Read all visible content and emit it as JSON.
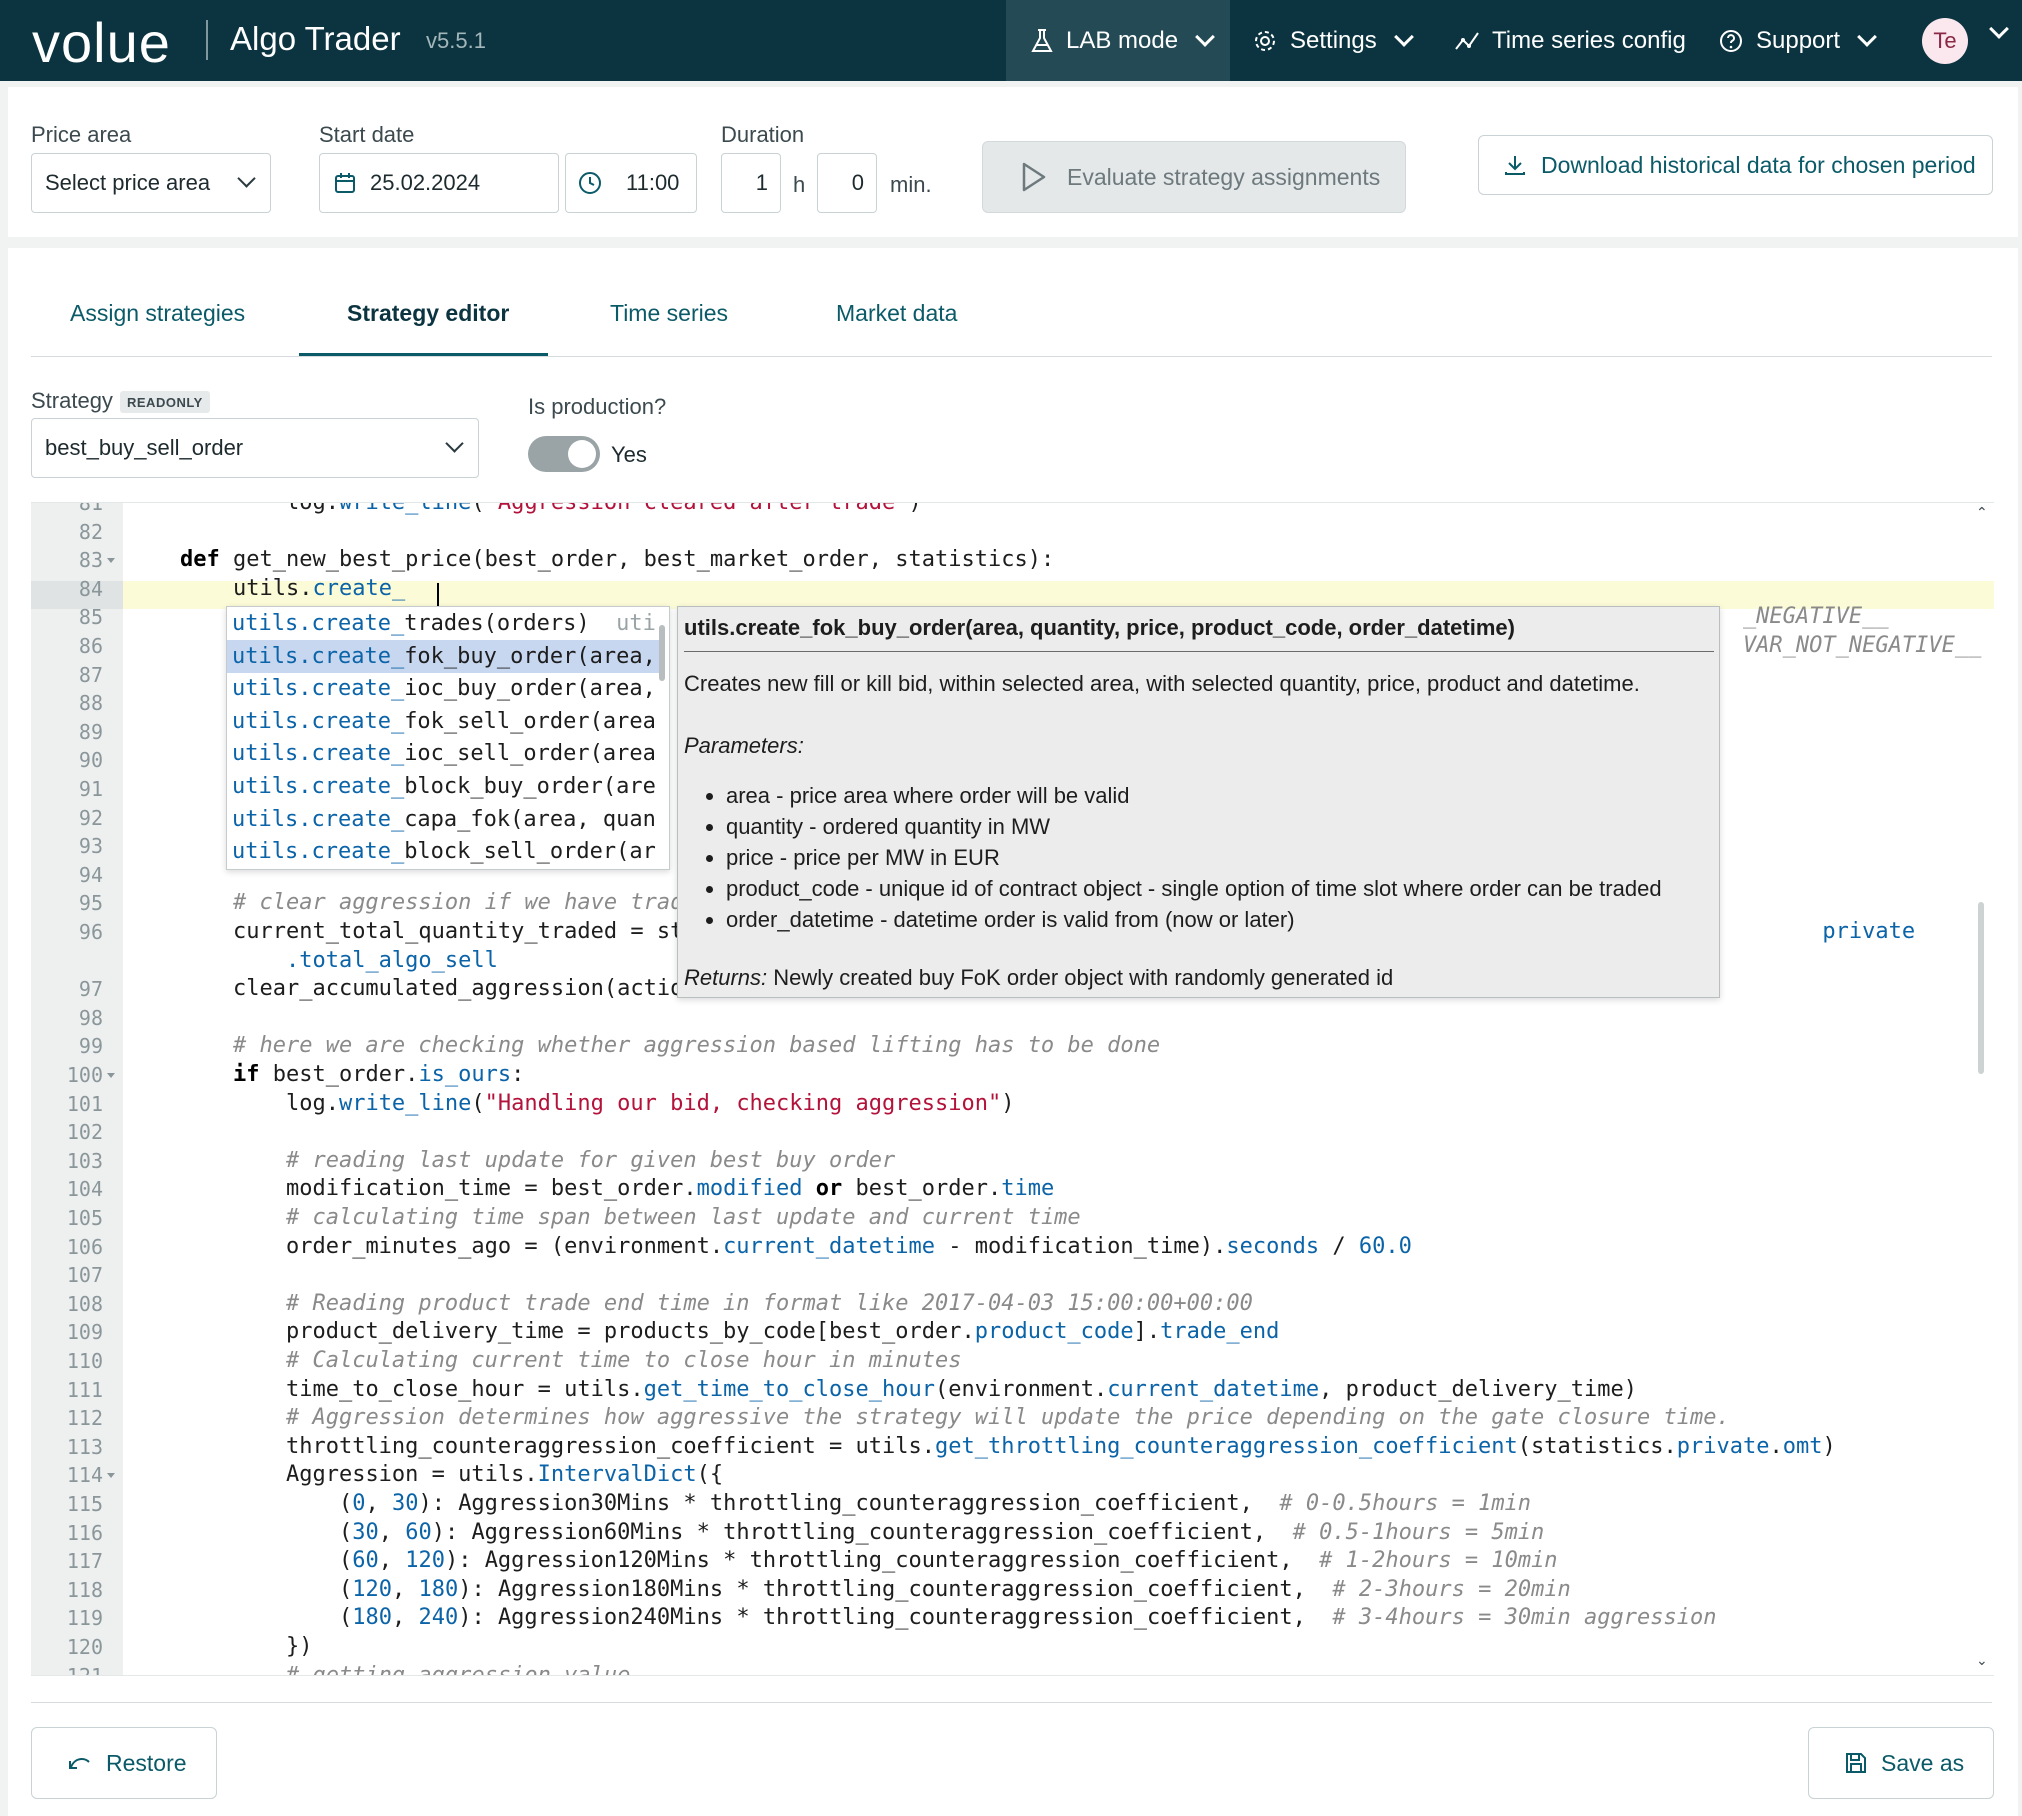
{
  "app": {
    "logo": "volue",
    "title": "Algo Trader",
    "version": "v5.5.1"
  },
  "nav": {
    "lab_mode": "LAB mode",
    "settings": "Settings",
    "time_series_config": "Time series config",
    "support": "Support",
    "avatar_initials": "Te"
  },
  "params": {
    "price_area_label": "Price area",
    "price_area_value": "Select price area",
    "start_date_label": "Start date",
    "start_date_value": "25.02.2024",
    "start_time_value": "11:00",
    "duration_label": "Duration",
    "duration_hours": "1",
    "hours_unit": "h",
    "duration_minutes": "0",
    "minutes_unit": "min.",
    "evaluate_label": "Evaluate strategy assignments",
    "download_label": "Download historical data for chosen period"
  },
  "tabs": [
    {
      "label": "Assign strategies"
    },
    {
      "label": "Strategy editor"
    },
    {
      "label": "Time series"
    },
    {
      "label": "Market data"
    }
  ],
  "strategy": {
    "label": "Strategy",
    "badge": "READONLY",
    "value": "best_buy_sell_order",
    "production_label": "Is production?",
    "production_value": "Yes"
  },
  "editor": {
    "lines": [
      {
        "n": "81",
        "indent": 2,
        "parts": [
          [
            "a",
            "log."
          ],
          [
            "p",
            "write_line"
          ],
          [
            "a",
            "("
          ],
          [
            "s",
            "\"Aggression cleared after trade\""
          ],
          [
            "a",
            ")"
          ]
        ]
      },
      {
        "n": "82",
        "indent": 0,
        "parts": []
      },
      {
        "n": "83",
        "indent": 0,
        "fold": true,
        "parts": [
          [
            "kw",
            "def"
          ],
          [
            "a",
            " get_new_best_price(best_order, best_market_order, statistics):"
          ]
        ]
      },
      {
        "n": "84",
        "indent": 1,
        "parts": [
          [
            "a",
            "utils."
          ],
          [
            "p",
            "create_"
          ]
        ]
      },
      {
        "n": "85",
        "indent": 0,
        "parts": [
          [
            "a",
            "                                                                                                                      "
          ],
          [
            "c",
            "_NEGATIVE__"
          ]
        ]
      },
      {
        "n": "86",
        "indent": 0,
        "parts": [
          [
            "a",
            "                                                                                                                      "
          ],
          [
            "c",
            "VAR_NOT_NEGATIVE__"
          ]
        ]
      },
      {
        "n": "87",
        "indent": 0,
        "parts": []
      },
      {
        "n": "88",
        "indent": 0,
        "parts": []
      },
      {
        "n": "89",
        "indent": 0,
        "parts": []
      },
      {
        "n": "90",
        "indent": 0,
        "parts": []
      },
      {
        "n": "91",
        "indent": 0,
        "parts": []
      },
      {
        "n": "92",
        "indent": 0,
        "parts": []
      },
      {
        "n": "93",
        "indent": 0,
        "parts": []
      },
      {
        "n": "94",
        "indent": 0,
        "parts": []
      },
      {
        "n": "95",
        "indent": 1,
        "parts": [
          [
            "c",
            "# clear aggression if we have trad"
          ]
        ]
      },
      {
        "n": "96",
        "indent": 1,
        "parts": [
          [
            "a",
            "current_total_quantity_traded = st"
          ],
          [
            "a",
            "                                                                                      "
          ],
          [
            "p",
            "private"
          ]
        ]
      },
      {
        "n": "",
        "indent": 2,
        "parts": [
          [
            "p",
            ".total_algo_sell"
          ]
        ]
      },
      {
        "n": "97",
        "indent": 1,
        "parts": [
          [
            "a",
            "clear_accumulated_aggression(actio"
          ]
        ]
      },
      {
        "n": "98",
        "indent": 0,
        "parts": []
      },
      {
        "n": "99",
        "indent": 1,
        "parts": [
          [
            "c",
            "# here we are checking whether aggression based lifting has to be done"
          ]
        ]
      },
      {
        "n": "100",
        "indent": 1,
        "fold": true,
        "parts": [
          [
            "kw",
            "if"
          ],
          [
            "a",
            " best_order."
          ],
          [
            "p",
            "is_ours"
          ],
          [
            "a",
            ":"
          ]
        ]
      },
      {
        "n": "101",
        "indent": 2,
        "parts": [
          [
            "a",
            "log."
          ],
          [
            "p",
            "write_line"
          ],
          [
            "a",
            "("
          ],
          [
            "s",
            "\"Handling our bid, checking aggression\""
          ],
          [
            "a",
            ")"
          ]
        ]
      },
      {
        "n": "102",
        "indent": 0,
        "parts": []
      },
      {
        "n": "103",
        "indent": 2,
        "parts": [
          [
            "c",
            "# reading last update for given best buy order"
          ]
        ]
      },
      {
        "n": "104",
        "indent": 2,
        "parts": [
          [
            "a",
            "modification_time = best_order."
          ],
          [
            "p",
            "modified"
          ],
          [
            "a",
            " "
          ],
          [
            "kw",
            "or"
          ],
          [
            "a",
            " best_order."
          ],
          [
            "p",
            "time"
          ]
        ]
      },
      {
        "n": "105",
        "indent": 2,
        "parts": [
          [
            "c",
            "# calculating time span between last update and current time"
          ]
        ]
      },
      {
        "n": "106",
        "indent": 2,
        "parts": [
          [
            "a",
            "order_minutes_ago = (environment."
          ],
          [
            "p",
            "current_datetime"
          ],
          [
            "a",
            " - modification_time)."
          ],
          [
            "p",
            "seconds"
          ],
          [
            "a",
            " / "
          ],
          [
            "n",
            "60.0"
          ]
        ]
      },
      {
        "n": "107",
        "indent": 0,
        "parts": []
      },
      {
        "n": "108",
        "indent": 2,
        "parts": [
          [
            "c",
            "# Reading product trade end time in format like 2017-04-03 15:00:00+00:00"
          ]
        ]
      },
      {
        "n": "109",
        "indent": 2,
        "parts": [
          [
            "a",
            "product_delivery_time = products_by_code[best_order."
          ],
          [
            "p",
            "product_code"
          ],
          [
            "a",
            "]."
          ],
          [
            "p",
            "trade_end"
          ]
        ]
      },
      {
        "n": "110",
        "indent": 2,
        "parts": [
          [
            "c",
            "# Calculating current time to close hour in minutes"
          ]
        ]
      },
      {
        "n": "111",
        "indent": 2,
        "parts": [
          [
            "a",
            "time_to_close_hour = utils."
          ],
          [
            "p",
            "get_time_to_close_hour"
          ],
          [
            "a",
            "(environment."
          ],
          [
            "p",
            "current_datetime"
          ],
          [
            "a",
            ", product_delivery_time)"
          ]
        ]
      },
      {
        "n": "112",
        "indent": 2,
        "parts": [
          [
            "c",
            "# Aggression determines how aggressive the strategy will update the price depending on the gate closure time."
          ]
        ]
      },
      {
        "n": "113",
        "indent": 2,
        "parts": [
          [
            "a",
            "throttling_counteraggression_coefficient = utils."
          ],
          [
            "p",
            "get_throttling_counteraggression_coefficient"
          ],
          [
            "a",
            "(statistics."
          ],
          [
            "p",
            "private"
          ],
          [
            "a",
            "."
          ],
          [
            "p",
            "omt"
          ],
          [
            "a",
            ")"
          ]
        ]
      },
      {
        "n": "114",
        "indent": 2,
        "fold": true,
        "parts": [
          [
            "a",
            "Aggression = utils."
          ],
          [
            "p",
            "IntervalDict"
          ],
          [
            "a",
            "({"
          ]
        ]
      },
      {
        "n": "115",
        "indent": 3,
        "parts": [
          [
            "a",
            "("
          ],
          [
            "n",
            "0"
          ],
          [
            "a",
            ", "
          ],
          [
            "n",
            "30"
          ],
          [
            "a",
            "): Aggression30Mins * throttling_counteraggression_coefficient,  "
          ],
          [
            "c",
            "# 0-0.5hours = 1min"
          ]
        ]
      },
      {
        "n": "116",
        "indent": 3,
        "parts": [
          [
            "a",
            "("
          ],
          [
            "n",
            "30"
          ],
          [
            "a",
            ", "
          ],
          [
            "n",
            "60"
          ],
          [
            "a",
            "): Aggression60Mins * throttling_counteraggression_coefficient,  "
          ],
          [
            "c",
            "# 0.5-1hours = 5min"
          ]
        ]
      },
      {
        "n": "117",
        "indent": 3,
        "parts": [
          [
            "a",
            "("
          ],
          [
            "n",
            "60"
          ],
          [
            "a",
            ", "
          ],
          [
            "n",
            "120"
          ],
          [
            "a",
            "): Aggression120Mins * throttling_counteraggression_coefficient,  "
          ],
          [
            "c",
            "# 1-2hours = 10min"
          ]
        ]
      },
      {
        "n": "118",
        "indent": 3,
        "parts": [
          [
            "a",
            "("
          ],
          [
            "n",
            "120"
          ],
          [
            "a",
            ", "
          ],
          [
            "n",
            "180"
          ],
          [
            "a",
            "): Aggression180Mins * throttling_counteraggression_coefficient,  "
          ],
          [
            "c",
            "# 2-3hours = 20min"
          ]
        ]
      },
      {
        "n": "119",
        "indent": 3,
        "parts": [
          [
            "a",
            "("
          ],
          [
            "n",
            "180"
          ],
          [
            "a",
            ", "
          ],
          [
            "n",
            "240"
          ],
          [
            "a",
            "): Aggression240Mins * throttling_counteraggression_coefficient,  "
          ],
          [
            "c",
            "# 3-4hours = 30min aggression"
          ]
        ]
      },
      {
        "n": "120",
        "indent": 2,
        "parts": [
          [
            "a",
            "})"
          ]
        ]
      },
      {
        "n": "121",
        "indent": 2,
        "parts": [
          [
            "c",
            "# getting aggression value"
          ]
        ]
      }
    ]
  },
  "autocomplete": {
    "items": [
      {
        "match": "utils.create_",
        "rest": "trades(orders)",
        "hint": "  uti",
        "selected": false
      },
      {
        "match": "utils.create_",
        "rest": "fok_buy_order(area,",
        "hint": "",
        "selected": true
      },
      {
        "match": "utils.create_",
        "rest": "ioc_buy_order(area,",
        "hint": "",
        "selected": false
      },
      {
        "match": "utils.create_",
        "rest": "fok_sell_order(area",
        "hint": "",
        "selected": false
      },
      {
        "match": "utils.create_",
        "rest": "ioc_sell_order(area",
        "hint": "",
        "selected": false
      },
      {
        "match": "utils.create_",
        "rest": "block_buy_order(are",
        "hint": "",
        "selected": false
      },
      {
        "match": "utils.create_",
        "rest": "capa_fok(area, quan",
        "hint": "",
        "selected": false
      },
      {
        "match": "utils.create_",
        "rest": "block_sell_order(ar",
        "hint": "",
        "selected": false
      }
    ]
  },
  "doc": {
    "signature": "utils.create_fok_buy_order(area, quantity, price, product_code, order_datetime)",
    "description": "Creates new fill or kill bid, within selected area, with selected quantity, price, product and datetime.",
    "params_heading": "Parameters:",
    "params": [
      "area -  price area where order will be valid",
      "quantity -  ordered quantity in MW",
      "price -  price per MW in EUR",
      "product_code -  unique id of contract object - single option of time slot where order can be traded",
      "order_datetime -  datetime order is valid from (now or later)"
    ],
    "returns_label": "Returns:",
    "returns_text": " Newly created buy FoK order object with randomly generated id"
  },
  "footer": {
    "restore_label": "Restore",
    "save_as_label": "Save as"
  },
  "colors": {
    "topbar": "#0b3440",
    "accent": "#0b5a68",
    "active_line": "#fcfbd7",
    "selected_suggestion": "#c7d7f0"
  }
}
